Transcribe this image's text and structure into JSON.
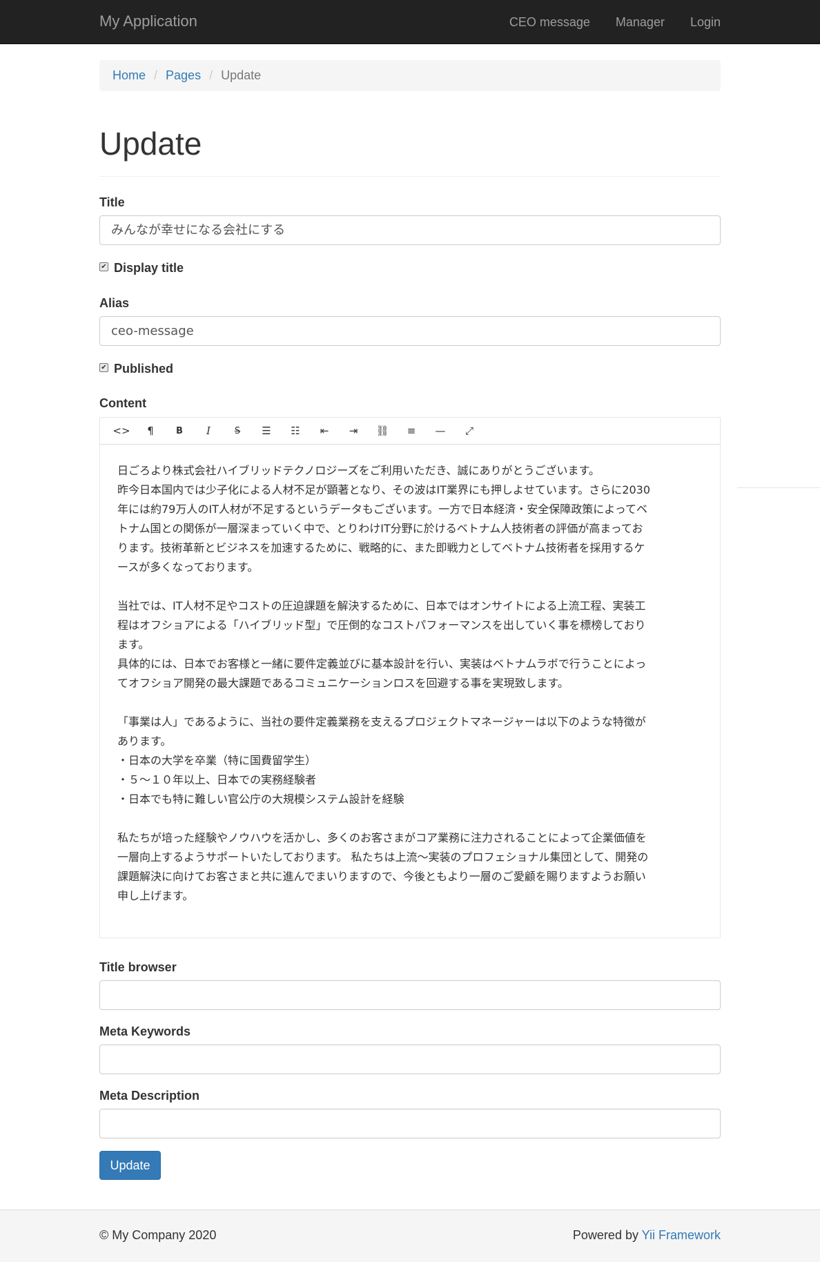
{
  "navbar": {
    "brand": "My Application",
    "links": [
      "CEO message",
      "Manager",
      "Login"
    ]
  },
  "breadcrumb": {
    "items": [
      "Home",
      "Pages"
    ],
    "active": "Update",
    "separator": "/"
  },
  "page_title": "Update",
  "form": {
    "title_label": "Title",
    "title_value": "みんなが幸せになる会社にする",
    "display_title_label": "Display title",
    "display_title_checked": true,
    "alias_label": "Alias",
    "alias_value": "ceo-message",
    "published_label": "Published",
    "published_checked": true,
    "content_label": "Content",
    "toolbar_icons": [
      "code-view-icon",
      "paragraph-icon",
      "bold-icon",
      "italic-icon",
      "strikethrough-icon",
      "unordered-list-icon",
      "ordered-list-icon",
      "outdent-icon",
      "indent-icon",
      "link-icon",
      "align-icon",
      "horizontal-rule-icon",
      "fullscreen-icon"
    ],
    "toolbar_glyphs": [
      "<>",
      "¶",
      "B",
      "I",
      "S",
      "☰",
      "☷",
      "⇤",
      "⇥",
      "⛓",
      "≡",
      "—",
      "⤢"
    ],
    "content": {
      "p1": [
        "日ごろより株式会社ハイブリッドテクノロジーズをご利用いただき、誠にありがとうございます。",
        "昨今日本国内では少子化による人材不足が顕著となり、その波はIT業界にも押しよせています。さらに2030",
        "年には約79万人のIT人材が不足するというデータもございます。一方で日本経済・安全保障政策によってベ",
        "トナム国との関係が一層深まっていく中で、とりわけIT分野に於けるベトナム人技術者の評価が高まってお",
        "ります。技術革新とビジネスを加速するために、戦略的に、また即戦力としてベトナム技術者を採用するケ",
        "ースが多くなっております。"
      ],
      "p2": [
        "当社では、IT人材不足やコストの圧迫課題を解決するために、日本ではオンサイトによる上流工程、実装工",
        "程はオフショアによる「ハイブリッド型」で圧倒的なコストパフォーマンスを出していく事を標榜しており",
        "ます。",
        "具体的には、日本でお客様と一緒に要件定義並びに基本設計を行い、実装はベトナムラボで行うことによっ",
        "てオフショア開発の最大課題であるコミュニケーションロスを回避する事を実現致します。"
      ],
      "p3": [
        "「事業は人」であるように、当社の要件定義業務を支えるプロジェクトマネージャーは以下のような特徴が",
        "あります。",
        "・日本の大学を卒業（特に国費留学生）",
        "・５～１０年以上、日本での実務経験者",
        "・日本でも特に難しい官公庁の大規模システム設計を経験"
      ],
      "p4": [
        "私たちが培った経験やノウハウを活かし、多くのお客さまがコア業務に注力されることによって企業価値を",
        "一層向上するようサポートいたしております。 私たちは上流～実装のプロフェショナル集団として、開発の",
        "課題解決に向けてお客さまと共に進んでまいりますので、今後ともより一層のご愛顧を賜りますようお願い",
        "申し上げます。"
      ]
    },
    "title_browser_label": "Title browser",
    "title_browser_value": "",
    "meta_keywords_label": "Meta Keywords",
    "meta_keywords_value": "",
    "meta_description_label": "Meta Description",
    "meta_description_value": "",
    "submit_label": "Update"
  },
  "footer": {
    "copyright": "© My Company 2020",
    "powered_prefix": "Powered by ",
    "powered_link": "Yii Framework"
  },
  "colors": {
    "navbar_bg": "#222222",
    "link": "#337ab7",
    "button_primary": "#337ab7"
  }
}
